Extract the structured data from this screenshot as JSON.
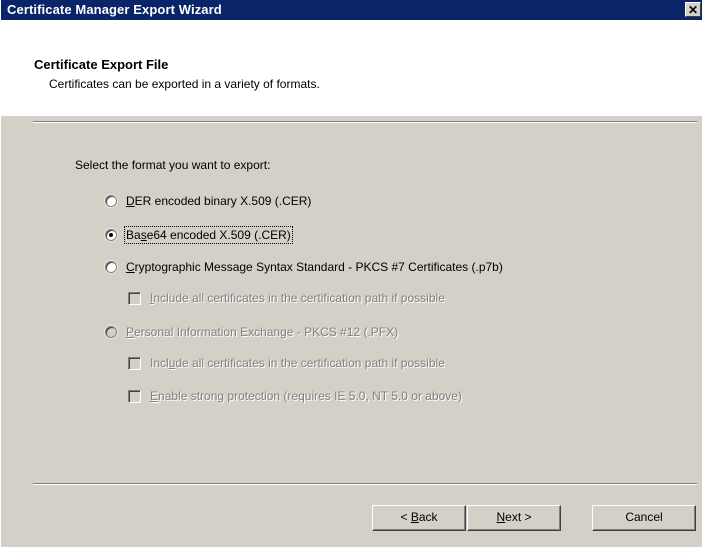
{
  "window": {
    "title": "Certificate Manager Export Wizard",
    "close_glyph": "✕"
  },
  "header": {
    "title": "Certificate Export File",
    "subtitle": "Certificates can be exported in a variety of formats."
  },
  "prompt": "Select the format you want to export:",
  "options": [
    {
      "mnemonic": "D",
      "rest": "ER encoded binary X.509 (.CER)",
      "selected": false,
      "enabled": true
    },
    {
      "pre": "Ba",
      "mnemonic": "s",
      "rest": "e64 encoded X.509 (.CER)",
      "selected": true,
      "enabled": true
    },
    {
      "mnemonic": "C",
      "rest": "ryptographic Message Syntax Standard - PKCS #7 Certificates (.p7b)",
      "selected": false,
      "enabled": true
    },
    {
      "mnemonic": "P",
      "rest": "ersonal Information Exchange - PKCS #12 (.PFX)",
      "selected": false,
      "enabled": false
    }
  ],
  "checkboxes": [
    {
      "mnemonic": "I",
      "rest": "nclude all certificates in the certification path if possible",
      "checked": false,
      "enabled": false
    },
    {
      "pre": "Incl",
      "mnemonic": "u",
      "rest": "de all certificates in the certification path if possible",
      "checked": false,
      "enabled": false
    },
    {
      "mnemonic": "E",
      "rest": "nable strong protection (requires IE 5.0, NT 5.0 or above)",
      "checked": false,
      "enabled": false
    }
  ],
  "buttons": {
    "back": {
      "prefix": "< ",
      "mnemonic": "B",
      "rest": "ack"
    },
    "next": {
      "mnemonic": "N",
      "rest": "ext >"
    },
    "cancel": {
      "label": "Cancel"
    }
  }
}
